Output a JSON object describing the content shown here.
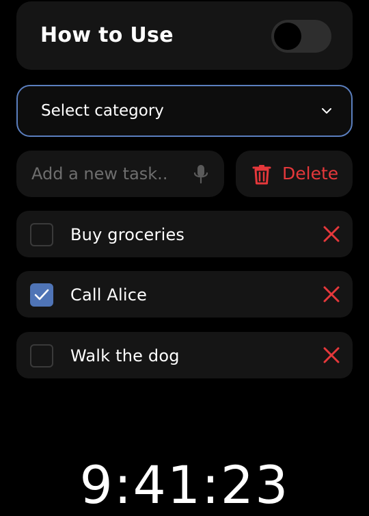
{
  "header": {
    "title": "How to Use",
    "toggle_on": false
  },
  "category_select": {
    "selected": "Select category",
    "icon": "chevron-down-icon"
  },
  "task_input": {
    "value": "",
    "placeholder": "Add a new task..",
    "icon": "microphone-icon"
  },
  "delete_button": {
    "label": "Delete",
    "icon": "trash-icon"
  },
  "tasks": [
    {
      "label": "Buy groceries",
      "checked": false
    },
    {
      "label": "Call Alice",
      "checked": true
    },
    {
      "label": "Walk the dog",
      "checked": false
    }
  ],
  "clock": {
    "time": "9:41:23"
  },
  "colors": {
    "background": "#000000",
    "card": "#151515",
    "accent_blue": "#4f74b6",
    "danger_red": "#e5383b",
    "placeholder": "#6e6e6e"
  }
}
